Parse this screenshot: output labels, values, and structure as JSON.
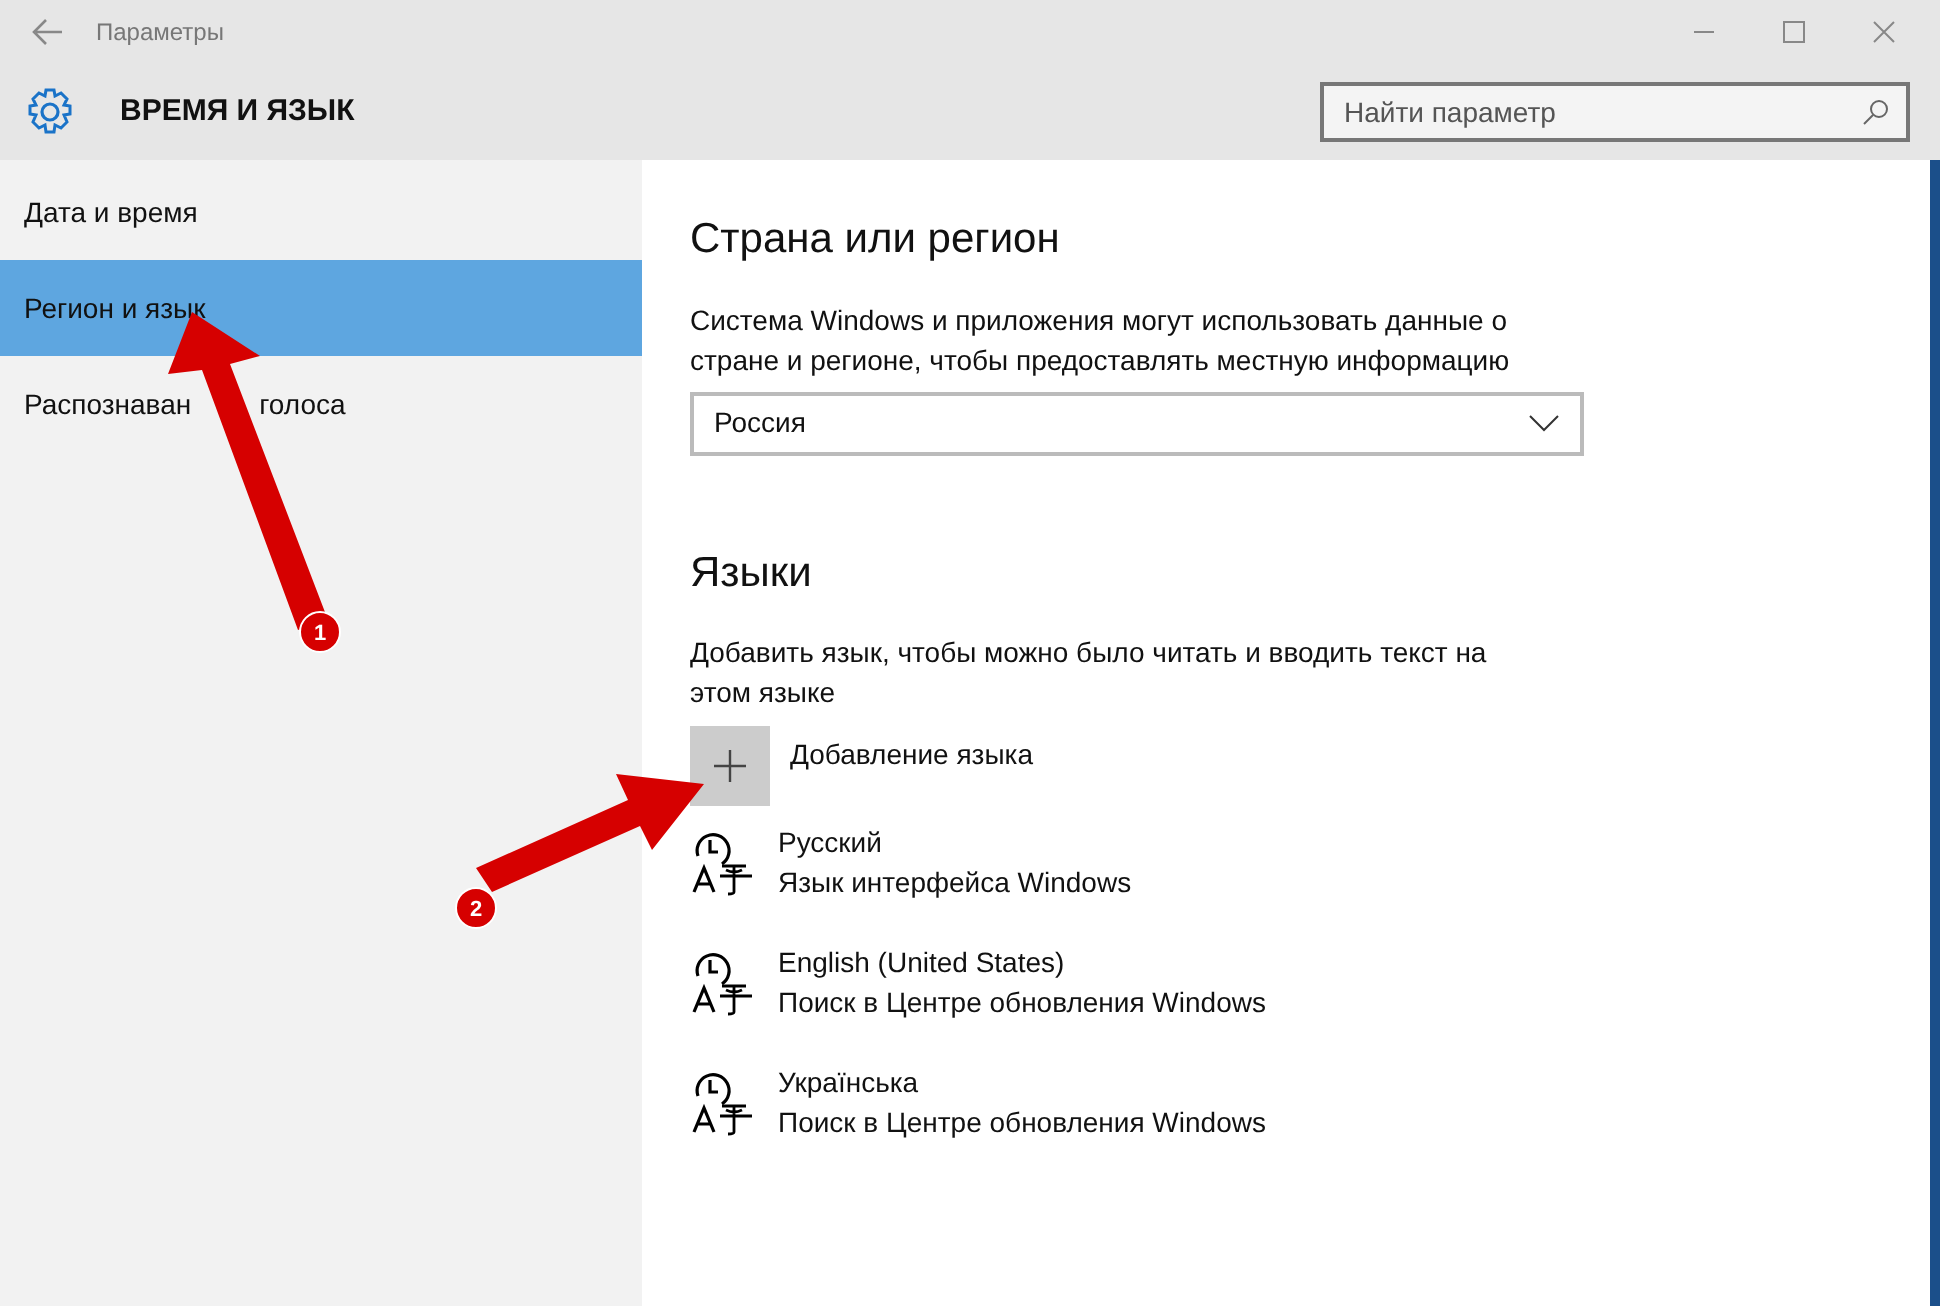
{
  "window": {
    "title": "Параметры"
  },
  "header": {
    "title": "ВРЕМЯ И ЯЗЫК",
    "search": {
      "placeholder": "Найти параметр"
    }
  },
  "sidebar": {
    "items": [
      {
        "label": "Дата и время",
        "selected": false
      },
      {
        "label": "Регион и язык",
        "selected": true
      },
      {
        "label": "Распознаван",
        "label_after": "голоса",
        "selected": false
      }
    ]
  },
  "region": {
    "title": "Страна или регион",
    "description": "Система Windows и приложения могут использовать данные о стране и регионе, чтобы предоставлять местную информацию",
    "dropdown": {
      "value": "Россия"
    }
  },
  "languages": {
    "title": "Языки",
    "description": "Добавить язык, чтобы можно было читать и вводить текст на этом языке",
    "add_button": "Добавление языка",
    "items": [
      {
        "name": "Русский",
        "status": "Язык интерфейса Windows"
      },
      {
        "name": "English (United States)",
        "status": "Поиск в Центре обновления Windows"
      },
      {
        "name": "Українська",
        "status": "Поиск в Центре обновления Windows"
      }
    ]
  },
  "annotations": [
    {
      "number": "1"
    },
    {
      "number": "2"
    }
  ]
}
